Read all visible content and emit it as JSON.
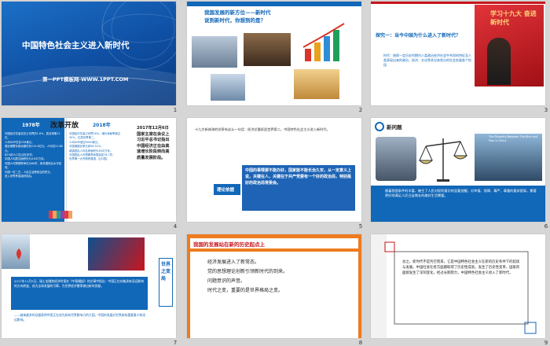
{
  "slides": [
    {
      "index": "1",
      "title": "中国特色社会主义进入新时代",
      "subtitle": "第一PPT模板网-WWW.1PPT.COM"
    },
    {
      "index": "2",
      "title": "我国发展的新方位——新时代",
      "subtitle": "说到新时代，你想到的是？"
    },
    {
      "index": "3",
      "question": "探究一：当今中国为什么进入了新时代？",
      "banner": "学习十九大 奋进新时代",
      "body": "时代：按照一定历史时期内人类政治经济社会中共同的特征及人类表现出来的政治、经济、文化等状况来划分的社会发展各个阶段"
    },
    {
      "index": "4",
      "left_year": "1978年",
      "heading": "改革开放",
      "right_year": "2018年",
      "left_list": [
        "中国经济总量仅仅占世界的1.8%，居全球第11位。",
        "人均GDP仅仅156美元。",
        "居民储蓄存款余额仅有210.6亿元，人均仅21.88元。",
        "82%的人口生活在农村。",
        "中国人均居住面积仅为3.6平方米。",
        "中国人均预期寿命仅为68岁，和多国相比水平较低。",
        "中国一穷二白，人民生活是相当的贫乏。",
        "进入世界贸易组织前后。"
      ],
      "right_list": [
        "中国经济总量占世界16%，增长贡献率超过30%，位居世界第二。",
        "人均GDP超过9000美元。",
        "中国城镇化率达到58.52%。",
        "城镇居民人均住房面积为36平方米。",
        "中国居民人均预期寿命提高到76.7岁。",
        "世界第一大货物贸易国、出口国。"
      ],
      "body": "2017年12月6日国家主席在会议上习近平总书记指出中国经济正在由高速增长阶段转向高质量发展阶段。"
    },
    {
      "index": "5",
      "intro": "十九大新修改的党章有这么一句话：经济总量跃居世界第二，中国特色社会主义进入新时代。",
      "quote": "中国的事情要不能办好，国家能不能长治久安，从一定意义上说，关键在人，关键在于共产党要有一个好的政治局，特别是好的政治局常委会。",
      "label": "理论依据"
    },
    {
      "index": "6",
      "title": "新问题",
      "chart_title": "The Disparity Between The Rich and Poor in China",
      "body": "随着我国条件的丰富，催生了人民对权利意识的显著觉醒，对幸福、保障、尊严、尊重的要求提高，需要更好地满足人民日益增长的美好生活需要。"
    },
    {
      "index": "7",
      "body": "2017年11月5日，瑞士金融和经济时报在《中国崛起》的文章中指出：中国正在向着具有深远影响的方向转变，成为全球发展的引擎，为世界经济繁荣做出新的贡献。",
      "body2": "——越来越多的证据表明中国正在成为具有世界影响力的大国，中国的发展对世界具有重要意义和深远影响。",
      "vertical": "世界之变局"
    },
    {
      "index": "8",
      "title": "我国的发展站在新的历史起点上",
      "lines": [
        "经济发展进入了新常态。",
        "党的思想理论创新引领新时代的到来。",
        "问题意识的声音。",
        "时代之变，重要的是世界格局之变。"
      ]
    },
    {
      "index": "9",
      "body": "总之，新时代不是凭空而来，它是中国特色社会主义在新的历史条件下的延续与发展。中国社会在各方面都取得了历史性成就，发生了历史性变革，国家的面貌发生了深刻变化，经过长期努力，中国特色社会主义进入了新时代。"
    }
  ],
  "colors": {
    "blue": "#1167b8",
    "dark_blue": "#0b3d91",
    "red": "#c8161d",
    "orange": "#ee7b1f",
    "green": "#16a34a"
  }
}
